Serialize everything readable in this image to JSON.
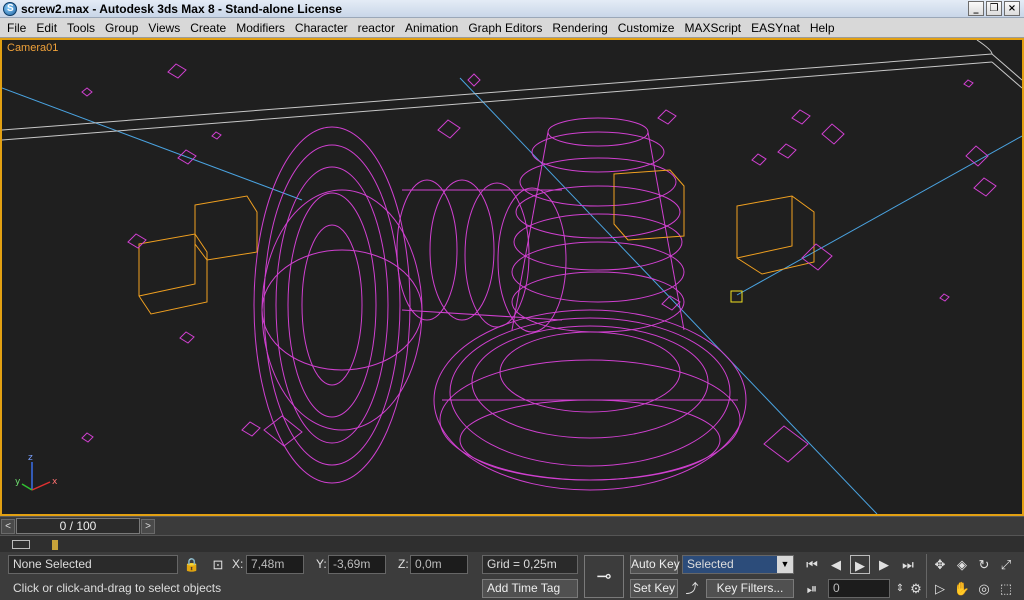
{
  "window": {
    "title": "screw2.max - Autodesk 3ds Max 8 - Stand-alone License",
    "app_icon_letter": "S",
    "controls": [
      "_",
      "❐",
      "×"
    ]
  },
  "menu": [
    "File",
    "Edit",
    "Tools",
    "Group",
    "Views",
    "Create",
    "Modifiers",
    "Character",
    "reactor",
    "Animation",
    "Graph Editors",
    "Rendering",
    "Customize",
    "MAXScript",
    "EASYnat",
    "Help"
  ],
  "viewport": {
    "label": "Camera01",
    "border_color": "#e2a012",
    "wire_color": "#d040d0",
    "axis_labels": [
      "z",
      "x",
      "y"
    ]
  },
  "timeline": {
    "frame_display": "0 / 100",
    "prev_label": "<",
    "next_label": ">"
  },
  "status": {
    "selection": "None Selected",
    "prompt": "Click or click-and-drag to select objects",
    "x_label": "X:",
    "x_value": "7,48m",
    "y_label": "Y:",
    "y_value": "-3,69m",
    "z_label": "Z:",
    "z_value": "0,0m",
    "grid": "Grid = 0,25m",
    "add_time_tag": "Add Time Tag",
    "auto_key": "Auto Key",
    "set_key": "Set Key",
    "key_mode": "Selected",
    "key_filters": "Key Filters...",
    "current_frame": "0"
  }
}
